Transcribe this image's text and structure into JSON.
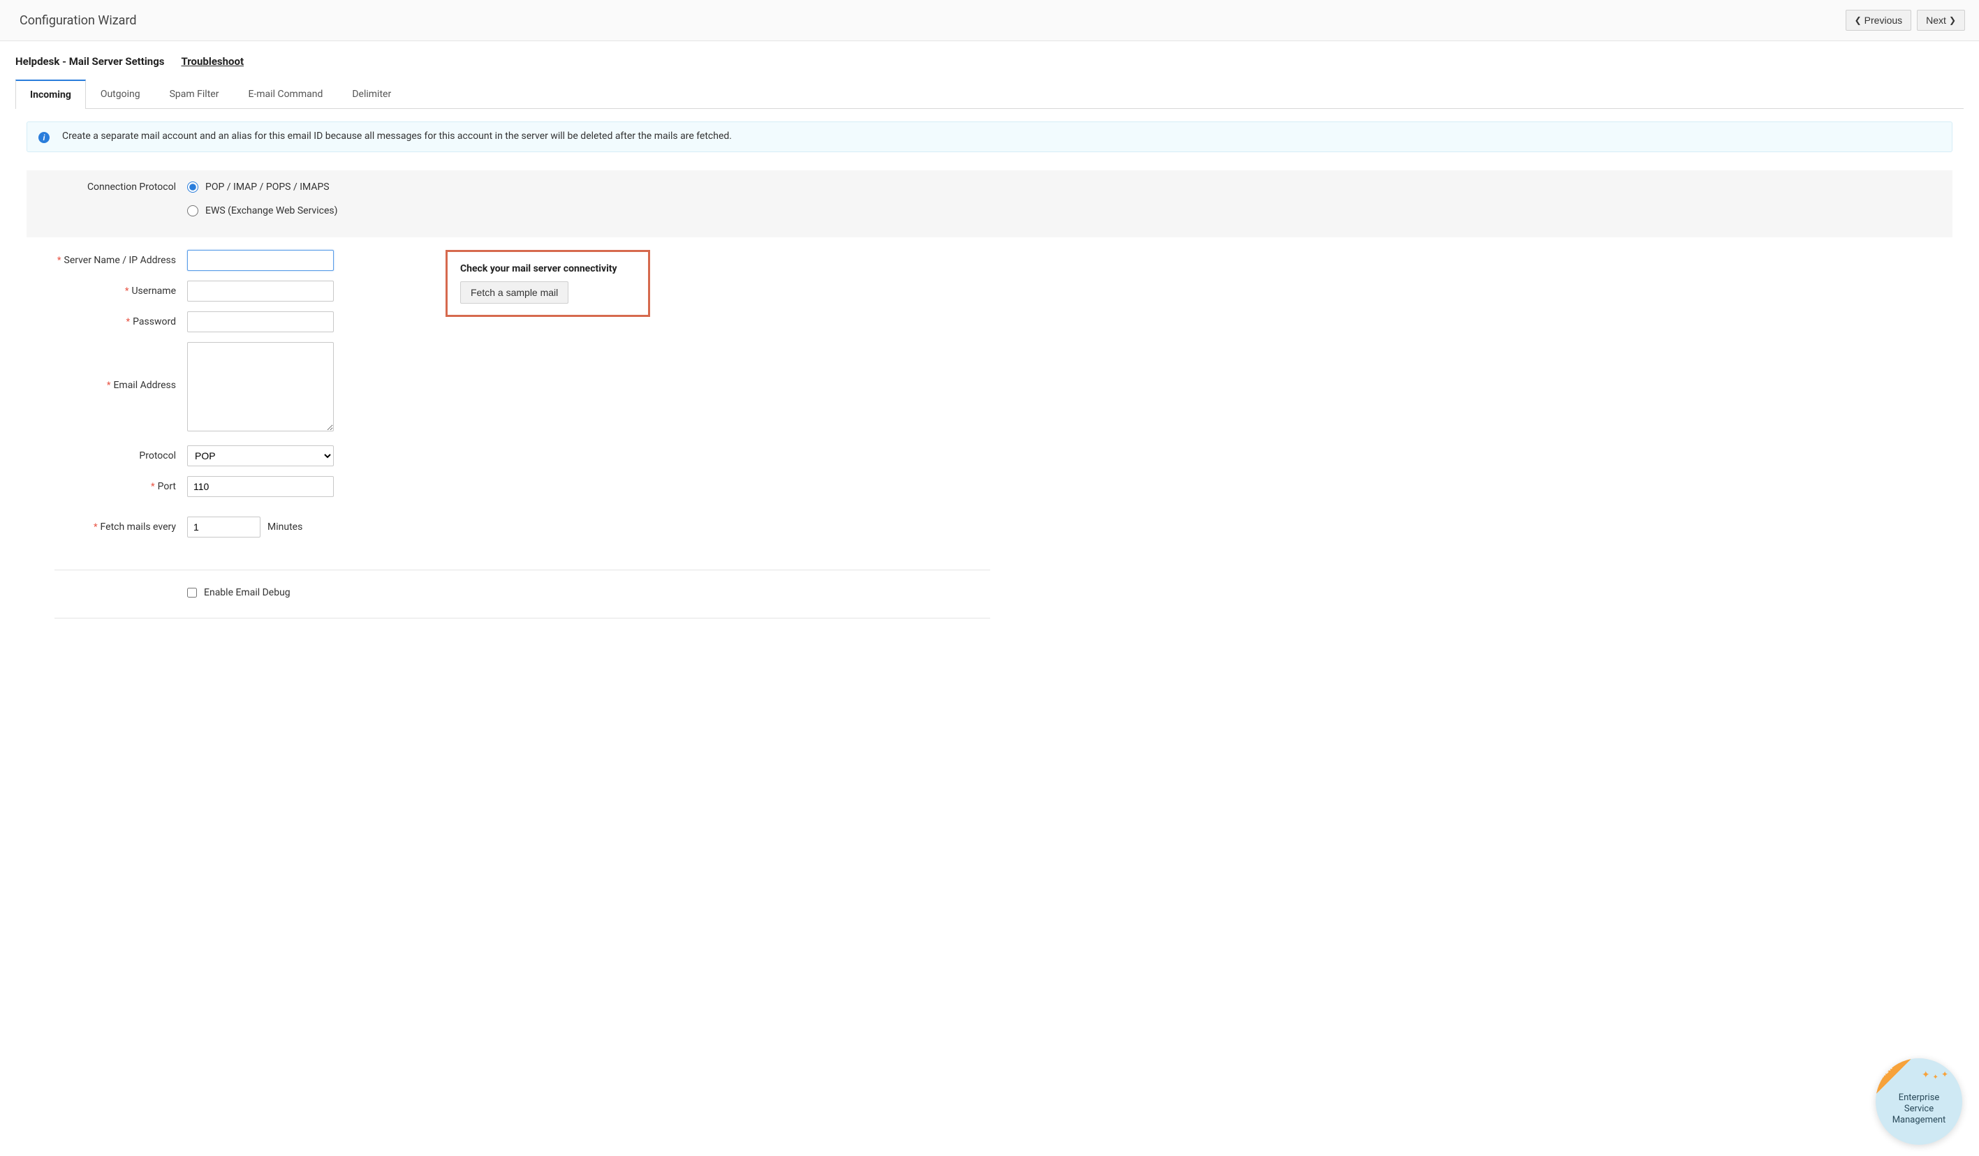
{
  "header": {
    "title": "Configuration Wizard",
    "previous_label": "Previous",
    "next_label": "Next"
  },
  "section": {
    "title": "Helpdesk - Mail Server Settings",
    "troubleshoot_link": "Troubleshoot"
  },
  "tabs": [
    {
      "label": "Incoming",
      "active": true
    },
    {
      "label": "Outgoing",
      "active": false
    },
    {
      "label": "Spam Filter",
      "active": false
    },
    {
      "label": "E-mail Command",
      "active": false
    },
    {
      "label": "Delimiter",
      "active": false
    }
  ],
  "info_text": "Create a separate mail account and an alias for this email ID because all messages for this account in the server will be deleted after the mails are fetched.",
  "form": {
    "connection_protocol_label": "Connection Protocol",
    "radio_pop_label": "POP / IMAP / POPS / IMAPS",
    "radio_ews_label": "EWS (Exchange Web Services)",
    "server_label": "Server Name / IP Address",
    "server_value": "",
    "username_label": "Username",
    "username_value": "",
    "password_label": "Password",
    "password_value": "",
    "email_label": "Email Address",
    "email_value": "",
    "protocol_label": "Protocol",
    "protocol_value": "POP",
    "port_label": "Port",
    "port_value": "110",
    "fetch_label": "Fetch mails every",
    "fetch_value": "1",
    "fetch_unit": "Minutes",
    "debug_label": "Enable Email Debug"
  },
  "connectivity": {
    "title": "Check your mail server connectivity",
    "button_label": "Fetch a sample mail"
  },
  "badge": {
    "new_label": "NEW",
    "line1": "Enterprise",
    "line2": "Service",
    "line3": "Management"
  }
}
